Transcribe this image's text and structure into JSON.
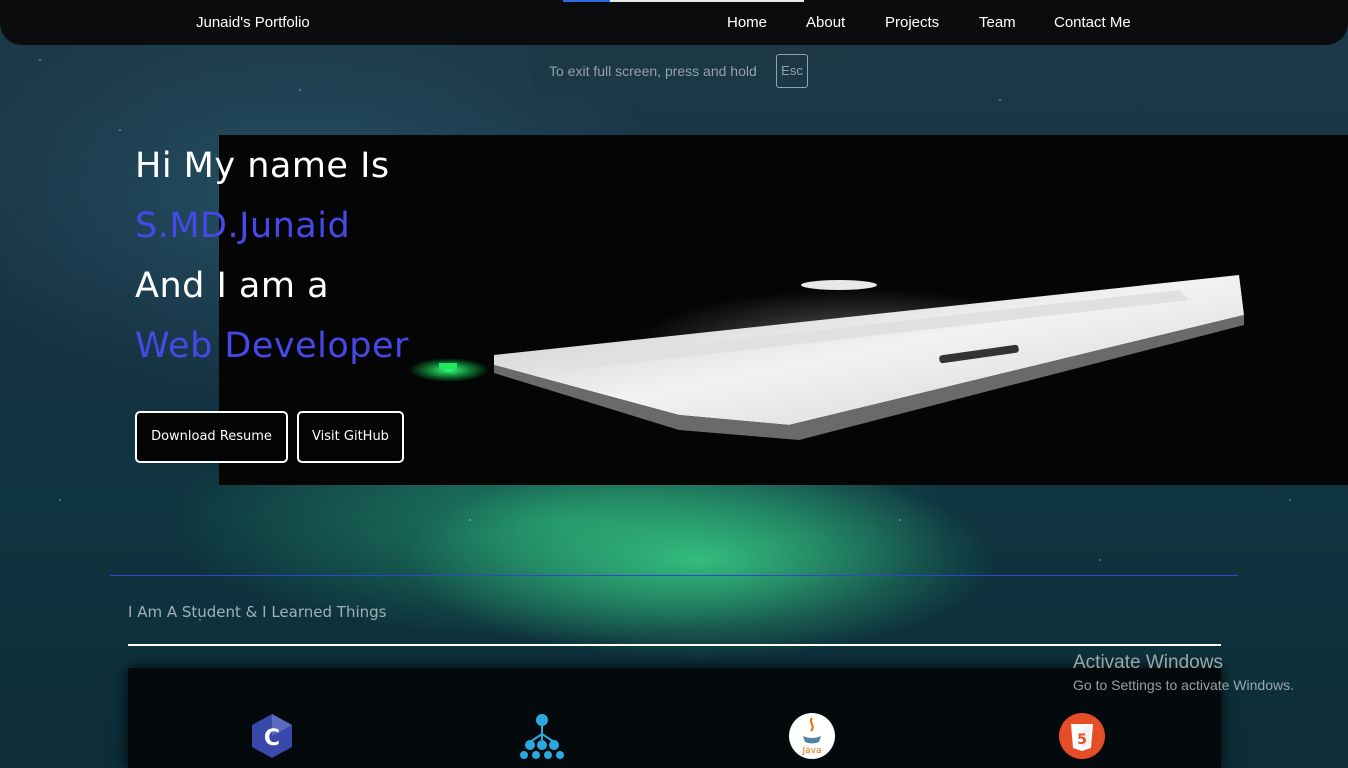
{
  "navbar": {
    "brand": "Junaid's Portfolio",
    "links": [
      "Home",
      "About",
      "Projects",
      "Team",
      "Contact Me"
    ],
    "accent_color": "#2d6be0"
  },
  "fullscreen_hint": {
    "message": "To exit full screen, press and hold",
    "key": "Esc"
  },
  "hero": {
    "greeting": "Hi My name Is",
    "name": "S.MD.Junaid",
    "intro": "And I am a",
    "role": "Web Developer",
    "accent_color": "#4649e6",
    "buttons": {
      "resume": "Download Resume",
      "github": "Visit GitHub"
    }
  },
  "learned": {
    "title": "I Am A Student & I Learned Things",
    "icons": [
      "c-language-icon",
      "data-structures-icon",
      "java-icon",
      "html5-icon"
    ]
  },
  "windows_watermark": {
    "title": "Activate Windows",
    "subtitle": "Go to Settings to activate Windows."
  }
}
